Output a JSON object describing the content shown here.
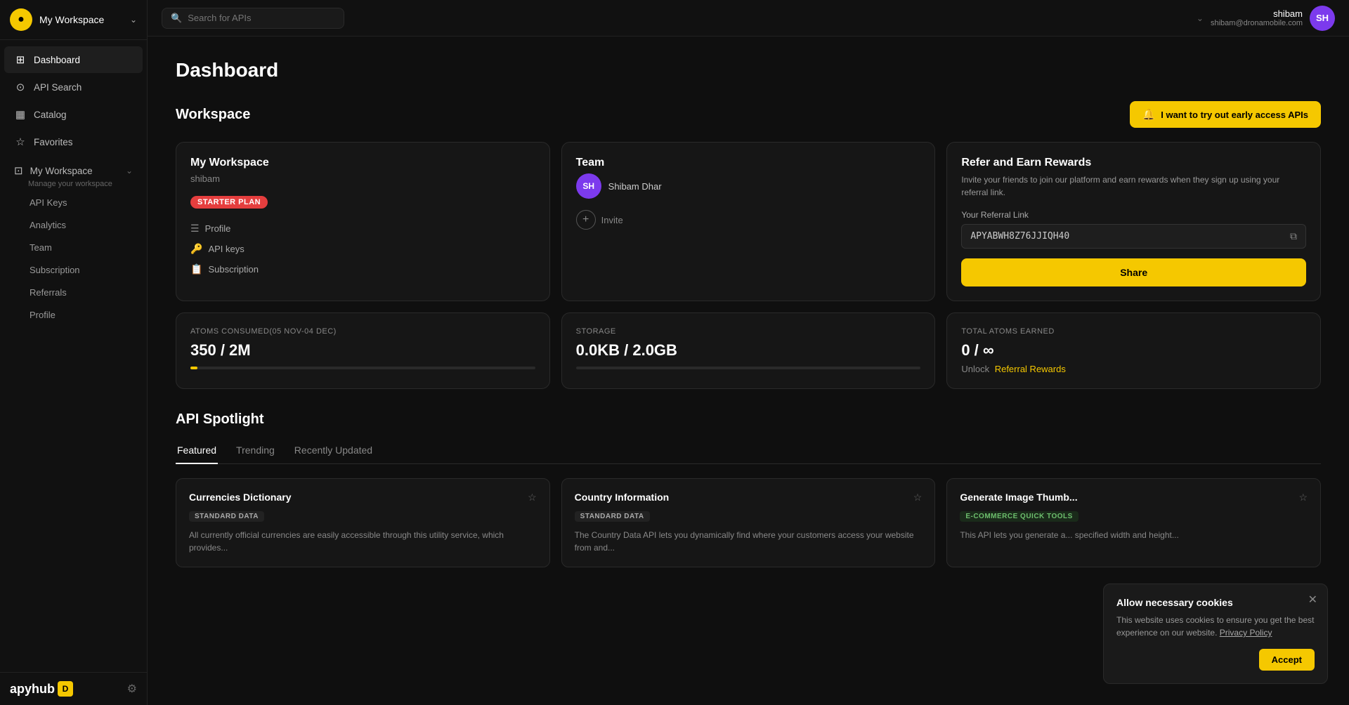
{
  "app": {
    "logo_letter": "●",
    "workspace_name": "My Workspace",
    "workspace_chevron": "⌄"
  },
  "sidebar": {
    "nav_items": [
      {
        "id": "dashboard",
        "icon": "⊞",
        "label": "Dashboard",
        "active": true
      },
      {
        "id": "api-search",
        "icon": "⊙",
        "label": "API Search",
        "active": false
      },
      {
        "id": "catalog",
        "icon": "▦",
        "label": "Catalog",
        "active": false
      },
      {
        "id": "favorites",
        "icon": "☆",
        "label": "Favorites",
        "active": false
      }
    ],
    "workspace_label": "My Workspace",
    "workspace_sub": "Manage your workspace",
    "workspace_chevron": "⌄",
    "workspace_children": [
      {
        "id": "api-keys",
        "label": "API Keys"
      },
      {
        "id": "analytics",
        "label": "Analytics"
      },
      {
        "id": "team",
        "label": "Team"
      },
      {
        "id": "subscription",
        "label": "Subscription"
      },
      {
        "id": "referrals",
        "label": "Referrals"
      },
      {
        "id": "profile",
        "label": "Profile"
      }
    ],
    "logo_text": "apyhub",
    "logo_badge": "D"
  },
  "topbar": {
    "search_placeholder": "Search for APIs",
    "user_name": "shibam",
    "user_email": "shibam@dronamobile.com",
    "user_initials": "SH",
    "chevron": "⌄"
  },
  "dashboard": {
    "page_title": "Dashboard",
    "workspace_section_title": "Workspace",
    "early_access_btn": "I want to try out early access APIs",
    "workspace_card": {
      "title": "My Workspace",
      "subtitle": "shibam",
      "badge": "STARTER PLAN",
      "links": [
        {
          "icon": "☰",
          "label": "Profile"
        },
        {
          "icon": "🔑",
          "label": "API keys"
        },
        {
          "icon": "📋",
          "label": "Subscription"
        }
      ]
    },
    "team_card": {
      "title": "Team",
      "member_initials": "SH",
      "member_name": "Shibam Dhar",
      "invite_label": "Invite",
      "invite_icon": "+"
    },
    "referral_card": {
      "title": "Refer and Earn Rewards",
      "description": "Invite your friends to join our platform and earn rewards when they sign up using your referral link.",
      "link_label": "Your Referral Link",
      "link_value": "APYABWH8Z76JJIQH40",
      "copy_icon": "⧉",
      "share_btn": "Share"
    },
    "stats": [
      {
        "label": "ATOMS CONSUMED(05 NOV-04 DEC)",
        "value": "350 / 2M",
        "bar_pct": 2,
        "bar_color": "#f5c800"
      },
      {
        "label": "STORAGE",
        "value": "0.0KB / 2.0GB",
        "bar_pct": 0,
        "bar_color": "#f5c800"
      },
      {
        "label": "TOTAL ATOMS EARNED",
        "value": "0 / ∞",
        "unlock_prefix": "Unlock",
        "unlock_link": "Referral Rewards"
      }
    ]
  },
  "spotlight": {
    "section_title": "API Spotlight",
    "tabs": [
      {
        "id": "featured",
        "label": "Featured",
        "active": true
      },
      {
        "id": "trending",
        "label": "Trending",
        "active": false
      },
      {
        "id": "recently-updated",
        "label": "Recently Updated",
        "active": false
      }
    ],
    "api_cards": [
      {
        "name": "Currencies Dictionary",
        "tag": "STANDARD DATA",
        "tag_class": "",
        "description": "All currently official currencies are easily accessible through this utility service, which provides..."
      },
      {
        "name": "Country Information",
        "tag": "STANDARD DATA",
        "tag_class": "",
        "description": "The Country Data API lets you dynamically find where your customers access your website from and..."
      },
      {
        "name": "Generate Image Thumb...",
        "tag": "E-COMMERCE QUICK TOOLS",
        "tag_class": "ecommerce",
        "description": "This API lets you generate a... specified width and height..."
      }
    ]
  },
  "cookie_banner": {
    "title": "Allow necessary cookies",
    "text": "This website uses cookies to ensure you get the best experience on our website.",
    "privacy_link": "Privacy Policy",
    "accept_btn": "Accept"
  }
}
